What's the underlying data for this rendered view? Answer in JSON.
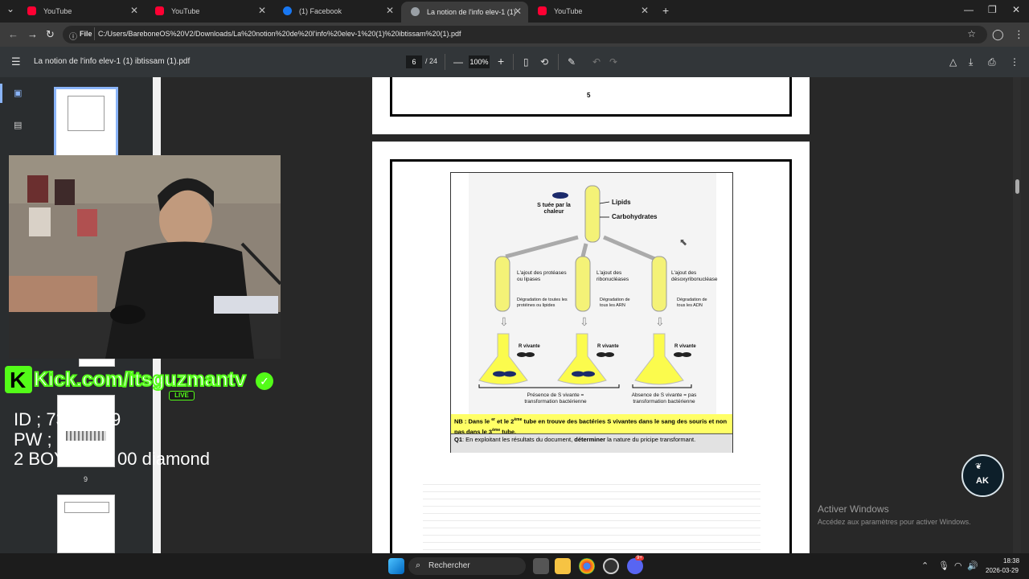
{
  "tabs": [
    {
      "label": "YouTube",
      "icon": "youtube-icon",
      "color": "#ff0033"
    },
    {
      "label": "YouTube",
      "icon": "youtube-icon",
      "color": "#ff0033"
    },
    {
      "label": "(1) Facebook",
      "icon": "facebook-icon",
      "color": "#1877f2"
    },
    {
      "label": "La notion de l'info elev-1 (1) ib",
      "icon": "globe-icon",
      "color": "#9aa0a6"
    },
    {
      "label": "YouTube",
      "icon": "youtube-icon",
      "color": "#ff0033"
    }
  ],
  "address": {
    "scheme_label": "File",
    "url": "C:/Users/BareboneOS%20V2/Downloads/La%20notion%20de%20l'info%20elev-1%20(1)%20ibtissam%20(1).pdf"
  },
  "pdf": {
    "title": "La notion de l'info elev-1 (1) ibtissam (1).pdf",
    "current_page": "6",
    "total_pages": "/ 24",
    "zoom": "100%"
  },
  "sidebar": {
    "thumb_label": "9"
  },
  "page_top": {
    "number": "5"
  },
  "figure": {
    "tube_label": "S tuée par la chaleur",
    "lipids": "Lipids",
    "carbs": "Carbohydrates",
    "add1": "L'ajout des protéases ou lipases",
    "add2": "L'ajout des ribonucléases",
    "add3": "L'ajout des désoxyribonucléase",
    "deg1": "Dégradation de toutes les protéines ou lipides",
    "deg2": "Dégradation de tous les ARN",
    "deg3": "Dégradation de tous les ADN",
    "rv1": "R vivante",
    "rv2": "R vivante",
    "rv3": "R vivante",
    "presence": "Présence de S vivante = transformation bactérienne",
    "absence": "Absence de S vivante = pas transformation bactérienne",
    "nb_pre": "NB : Dans le ",
    "nb_sup1": "er",
    "nb_mid1": " et le 2",
    "nb_sup2": "ème",
    "nb_mid2": " tube en trouve des bactéries S vivantes dans le sang des souris et non pas dans le 3",
    "nb_sup3": "ème",
    "nb_end": " tube.",
    "q1_label": "Q1",
    "q1_pre": ": En exploitant les résultats du document, ",
    "q1_bold": "déterminer",
    "q1_post": " la nature du pricipe transformant."
  },
  "overlay": {
    "kick": "Kick.com/itsguzmantv",
    "live": "LIVE",
    "line1": "ID ; 73",
    "line1b": "9",
    "line2": "PW ; (",
    "line3": "2 BOY",
    "line3b": "00 diamond"
  },
  "watermark": {
    "title": "Activer Windows",
    "sub": "Accédez aux paramètres pour activer Windows."
  },
  "badge": {
    "text": "AK"
  },
  "taskbar": {
    "search": "Rechercher",
    "time": "18:38",
    "date": "2026-03-29",
    "discord_count": "9+"
  },
  "colors": {
    "accent": "#8ab4f8",
    "kick_green": "#53fc18",
    "highlight": "#ffff66"
  }
}
